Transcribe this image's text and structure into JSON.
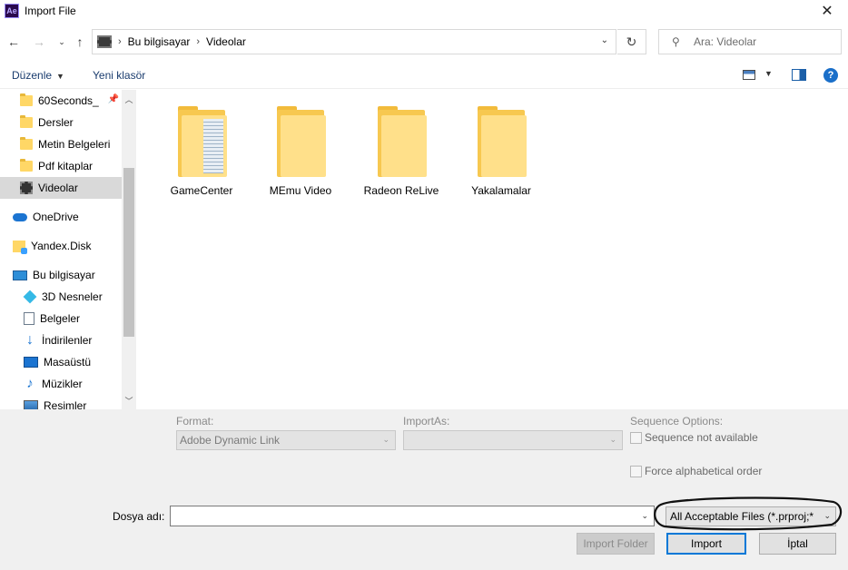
{
  "window": {
    "title": "Import File",
    "app_icon": "Ae"
  },
  "address": {
    "crumbs": [
      "Bu bilgisayar",
      "Videolar"
    ]
  },
  "search": {
    "placeholder": "Ara: Videolar"
  },
  "toolbar": {
    "organize_label": "Düzenle",
    "new_folder_label": "Yeni klasör",
    "help_glyph": "?"
  },
  "sidebar": {
    "items": [
      {
        "label": "60Seconds_",
        "icon": "folder-icon",
        "pinned": true
      },
      {
        "label": "Dersler",
        "icon": "folder-icon"
      },
      {
        "label": "Metin Belgeleri",
        "icon": "folder-icon"
      },
      {
        "label": "Pdf kitaplar",
        "icon": "folder-icon"
      },
      {
        "label": "Videolar",
        "icon": "video-folder-icon",
        "selected": true
      },
      {
        "label": "OneDrive",
        "icon": "cloud-icon"
      },
      {
        "label": "Yandex.Disk",
        "icon": "yandex-disk-icon"
      },
      {
        "label": "Bu bilgisayar",
        "icon": "computer-icon"
      },
      {
        "label": "3D Nesneler",
        "icon": "3d-objects-icon"
      },
      {
        "label": "Belgeler",
        "icon": "documents-icon"
      },
      {
        "label": "İndirilenler",
        "icon": "downloads-icon"
      },
      {
        "label": "Masaüstü",
        "icon": "desktop-icon"
      },
      {
        "label": "Müzikler",
        "icon": "music-icon"
      },
      {
        "label": "Resimler",
        "icon": "pictures-icon"
      }
    ]
  },
  "files": [
    {
      "name": "GameCenter"
    },
    {
      "name": "MEmu Video"
    },
    {
      "name": "Radeon ReLive"
    },
    {
      "name": "Yakalamalar"
    }
  ],
  "options": {
    "format_label": "Format:",
    "format_value": "Adobe Dynamic Link",
    "import_as_label": "ImportAs:",
    "import_as_value": "",
    "sequence_label": "Sequence Options:",
    "sequence_not_available": "Sequence not available",
    "force_alpha": "Force alphabetical order"
  },
  "filename": {
    "label": "Dosya adı:",
    "value": ""
  },
  "filter": {
    "value": "All Acceptable Files (*.prproj;*"
  },
  "buttons": {
    "import_folder": "Import Folder",
    "import": "Import",
    "cancel": "İptal"
  },
  "colors": {
    "accent": "#0078d7",
    "folder": "#ffd766",
    "selected_row": "#d9d9d9"
  }
}
